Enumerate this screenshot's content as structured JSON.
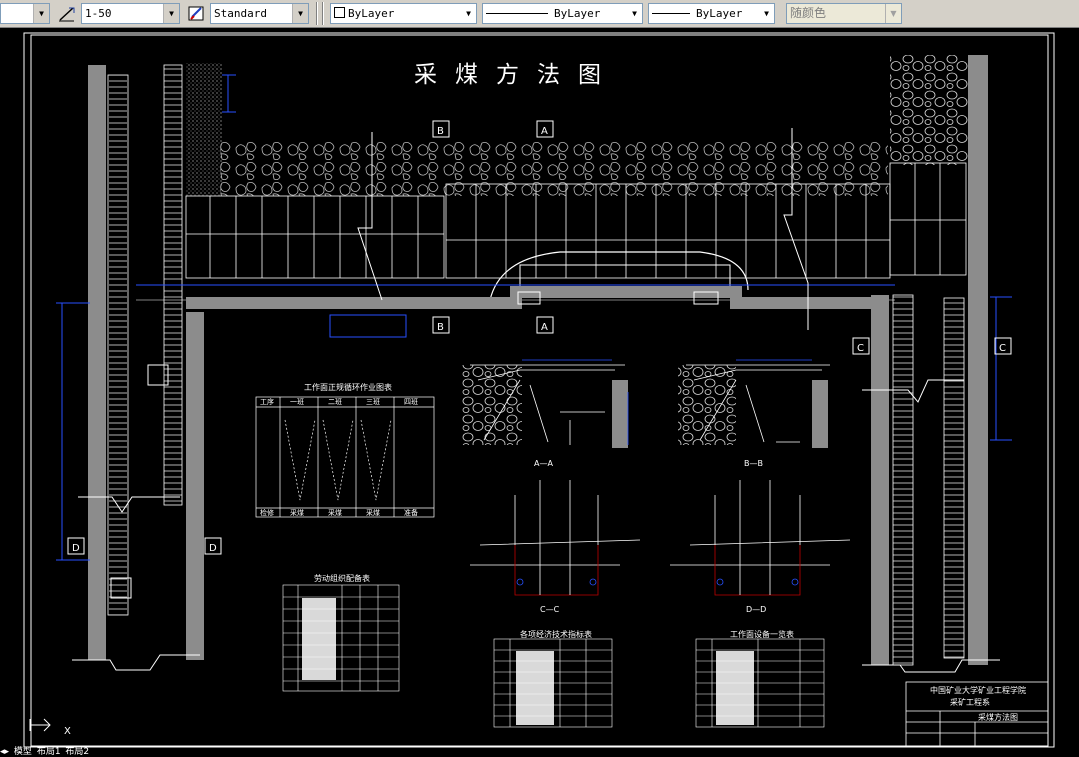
{
  "toolbar": {
    "dimstyle_value": "1-50",
    "textstyle_value": "Standard",
    "color_value": "ByLayer",
    "linetype_value": "ByLayer",
    "lineweight_value": "ByLayer",
    "plotstyle_value": "随颜色"
  },
  "drawing": {
    "title": "采煤方法图",
    "section_labels": {
      "b_top": "B",
      "a_top": "A",
      "b_bottom": "B",
      "a_bottom": "A",
      "c_left": "C",
      "c_right": "C",
      "d_left": "D",
      "d_right": "D"
    },
    "section_captions": {
      "aa": "A—A",
      "bb": "B—B",
      "cc": "C—C",
      "dd": "D—D"
    },
    "table_cycle_title": "工作面正规循环作业图表",
    "table_labor_title": "劳动组织配备表",
    "table_tech_title": "各项经济技术指标表",
    "table_equip_title": "工作面设备一览表",
    "titleblock": {
      "institution": "中国矿业大学矿业工程学院",
      "project": "采矿工程系",
      "drawing_name": "采煤方法图"
    },
    "cycle_headers": [
      "工序",
      "一班",
      "二班",
      "三班",
      "四班"
    ],
    "cycle_footer": [
      "检修",
      "采煤",
      "采煤",
      "采煤",
      "准备"
    ]
  },
  "tabs": {
    "model": "模型",
    "layout1": "布局1",
    "layout2": "布局2"
  },
  "ucs_axis_label": "X"
}
